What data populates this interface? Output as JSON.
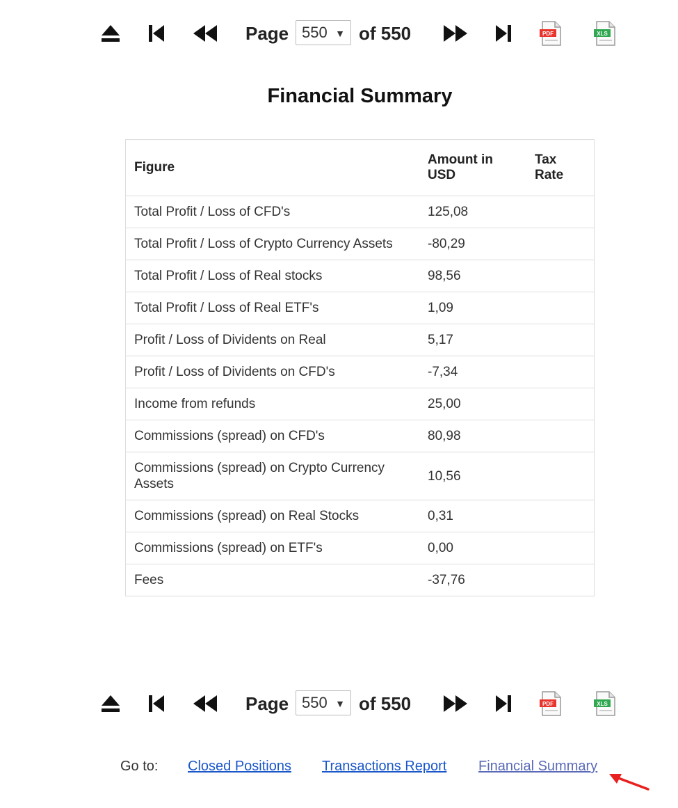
{
  "pager": {
    "page_label": "Page",
    "current_page": "550",
    "of_label": "of 550"
  },
  "title": "Financial Summary",
  "table": {
    "headers": [
      "Figure",
      "Amount in USD",
      "Tax Rate"
    ],
    "rows": [
      {
        "figure": "Total Profit / Loss of CFD's",
        "amount": "125,08",
        "tax": ""
      },
      {
        "figure": "Total Profit / Loss of Crypto Currency Assets",
        "amount": "-80,29",
        "tax": ""
      },
      {
        "figure": "Total Profit / Loss of Real stocks",
        "amount": "98,56",
        "tax": ""
      },
      {
        "figure": "Total Profit / Loss of Real ETF's",
        "amount": "1,09",
        "tax": ""
      },
      {
        "figure": "Profit / Loss of Dividents on Real",
        "amount": "5,17",
        "tax": ""
      },
      {
        "figure": "Profit / Loss of Dividents on CFD's",
        "amount": "-7,34",
        "tax": ""
      },
      {
        "figure": "Income from refunds",
        "amount": "25,00",
        "tax": ""
      },
      {
        "figure": "Commissions (spread) on CFD's",
        "amount": "80,98",
        "tax": ""
      },
      {
        "figure": "Commissions (spread) on Crypto Currency Assets",
        "amount": "10,56",
        "tax": ""
      },
      {
        "figure": "Commissions (spread) on Real Stocks",
        "amount": "0,31",
        "tax": ""
      },
      {
        "figure": "Commissions (spread) on ETF's",
        "amount": "0,00",
        "tax": ""
      },
      {
        "figure": "Fees",
        "amount": "-37,76",
        "tax": ""
      }
    ]
  },
  "goto": {
    "label": "Go to:",
    "links": [
      "Closed Positions",
      "Transactions Report",
      "Financial Summary"
    ]
  },
  "icons": {
    "eject": "eject-icon",
    "first": "first-page-icon",
    "prev": "rewind-icon",
    "next": "fast-forward-icon",
    "last": "last-page-icon",
    "pdf": "pdf-icon",
    "xls": "xls-icon",
    "pdf_text": "PDF",
    "xls_text": "XLS"
  },
  "colors": {
    "link": "#1a57c9",
    "visited_link": "#5a6ab8",
    "arrow": "#e8201f",
    "pdf_badge": "#e8342d",
    "xls_badge": "#2fa84f"
  }
}
